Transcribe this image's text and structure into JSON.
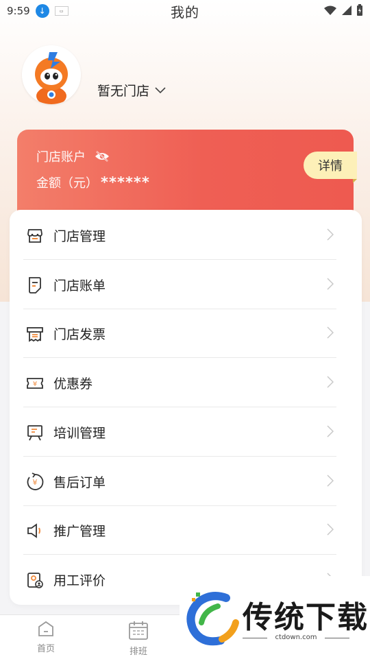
{
  "status_bar": {
    "time": "9:59"
  },
  "header": {
    "title": "我的"
  },
  "profile": {
    "store_name": "暂无门店"
  },
  "account": {
    "title": "门店账户",
    "amount_label": "金额（元）",
    "amount_masked": "******",
    "detail_label": "详情"
  },
  "menu": {
    "items": [
      {
        "label": "门店管理",
        "icon": "store-icon"
      },
      {
        "label": "门店账单",
        "icon": "bill-icon"
      },
      {
        "label": "门店发票",
        "icon": "invoice-icon"
      },
      {
        "label": "优惠券",
        "icon": "coupon-icon"
      },
      {
        "label": "培训管理",
        "icon": "training-icon"
      },
      {
        "label": "售后订单",
        "icon": "after-sales-icon"
      },
      {
        "label": "推广管理",
        "icon": "promotion-icon"
      },
      {
        "label": "用工评价",
        "icon": "evaluation-icon"
      }
    ]
  },
  "tabbar": {
    "tabs": [
      {
        "label": "首页",
        "icon": "home-icon"
      },
      {
        "label": "排班",
        "icon": "calendar-icon"
      }
    ]
  },
  "watermark": {
    "brand": "传统下载",
    "url": "ctdown.com"
  },
  "colors": {
    "card_start": "#f37e6a",
    "card_end": "#ee5a50",
    "detail_bg": "#fdf0b8",
    "icon_stroke": "#333333",
    "icon_accent": "#f08a3c"
  }
}
